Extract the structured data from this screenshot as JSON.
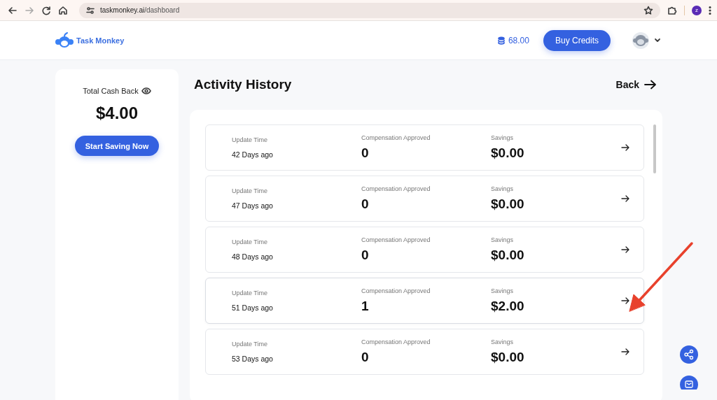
{
  "browser": {
    "url_host": "taskmonkey.ai",
    "url_path": "/dashboard",
    "profile_initial": "z"
  },
  "header": {
    "logo_text": "Task Monkey",
    "credits": "68.00",
    "buy_button": "Buy Credits"
  },
  "sidebar": {
    "label": "Total Cash Back",
    "amount": "$4.00",
    "button": "Start Saving Now"
  },
  "page": {
    "title": "Activity History",
    "back": "Back"
  },
  "rows": [
    {
      "time_label": "Update Time",
      "time": "42 Days ago",
      "comp_label": "Compensation Approved",
      "comp": "0",
      "savings_label": "Savings",
      "savings": "$0.00",
      "highlighted": false
    },
    {
      "time_label": "Update Time",
      "time": "47 Days ago",
      "comp_label": "Compensation Approved",
      "comp": "0",
      "savings_label": "Savings",
      "savings": "$0.00",
      "highlighted": false
    },
    {
      "time_label": "Update Time",
      "time": "48 Days ago",
      "comp_label": "Compensation Approved",
      "comp": "0",
      "savings_label": "Savings",
      "savings": "$0.00",
      "highlighted": false
    },
    {
      "time_label": "Update Time",
      "time": "51 Days ago",
      "comp_label": "Compensation Approved",
      "comp": "1",
      "savings_label": "Savings",
      "savings": "$2.00",
      "highlighted": true
    },
    {
      "time_label": "Update Time",
      "time": "53 Days ago",
      "comp_label": "Compensation Approved",
      "comp": "0",
      "savings_label": "Savings",
      "savings": "$0.00",
      "highlighted": false
    }
  ]
}
